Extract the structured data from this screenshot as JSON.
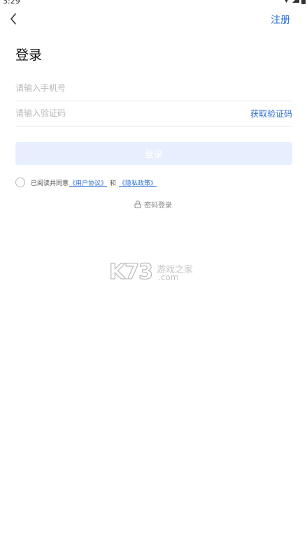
{
  "status_bar": {
    "time": "3:29"
  },
  "header": {
    "register_label": "注册"
  },
  "page": {
    "title": "登录"
  },
  "form": {
    "phone_placeholder": "请输入手机号",
    "code_placeholder": "请输入验证码",
    "get_code_label": "获取验证码",
    "login_label": "登录"
  },
  "agreement": {
    "prefix": "已阅读并同意",
    "user_agreement": "《用户协议》",
    "and": "和",
    "privacy_policy": "《隐私政策》"
  },
  "alt_login": {
    "password_login_label": "密码登录"
  },
  "watermark": {
    "brand": "K73",
    "cn_text": "游戏之家",
    "domain": ".com"
  },
  "colors": {
    "accent": "#2f6fd6",
    "login_button_bg": "#e7efff"
  }
}
